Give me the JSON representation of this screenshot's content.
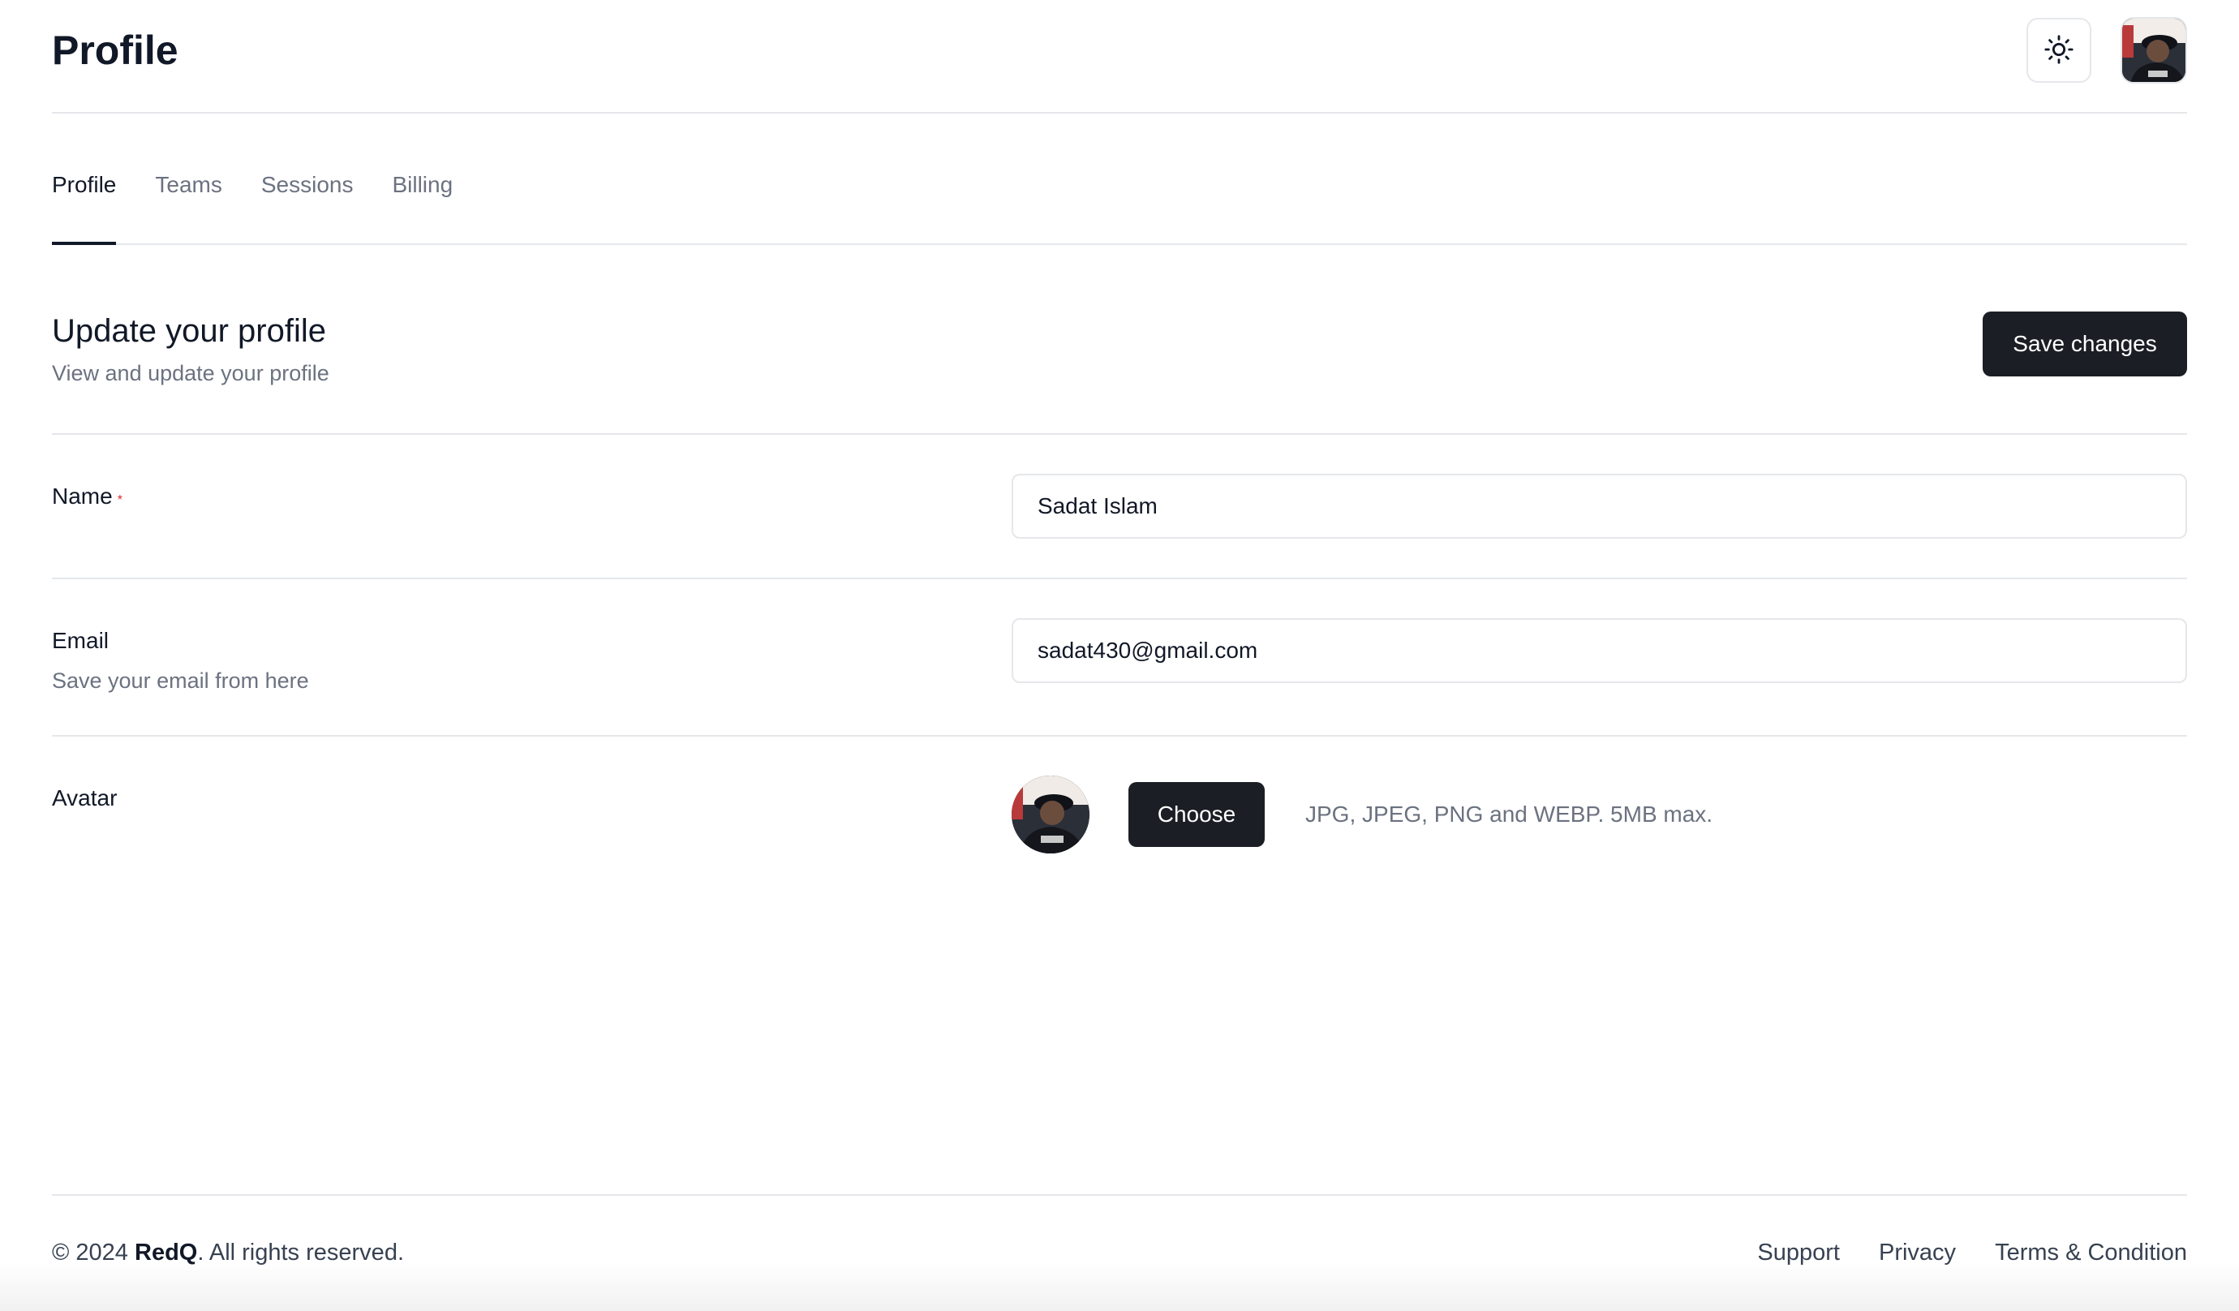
{
  "header": {
    "title": "Profile",
    "theme_icon": "sun-icon"
  },
  "tabs": [
    {
      "label": "Profile",
      "active": true
    },
    {
      "label": "Teams",
      "active": false
    },
    {
      "label": "Sessions",
      "active": false
    },
    {
      "label": "Billing",
      "active": false
    }
  ],
  "section": {
    "title": "Update your profile",
    "subtitle": "View and update your profile",
    "save_label": "Save changes"
  },
  "form": {
    "name": {
      "label": "Name",
      "required_mark": "*",
      "value": "Sadat Islam"
    },
    "email": {
      "label": "Email",
      "help": "Save your email from here",
      "value": "sadat430@gmail.com"
    },
    "avatar": {
      "label": "Avatar",
      "choose_label": "Choose",
      "hint": "JPG, JPEG, PNG and WEBP. 5MB max."
    }
  },
  "footer": {
    "copyright_prefix": "© 2024 ",
    "brand": "RedQ",
    "copyright_suffix": ". All rights reserved.",
    "links": [
      "Support",
      "Privacy",
      "Terms & Condition"
    ]
  },
  "colors": {
    "primary_button": "#1b1e24",
    "required": "#dc2626",
    "muted_text": "#6b7280",
    "border": "#e5e7eb"
  }
}
